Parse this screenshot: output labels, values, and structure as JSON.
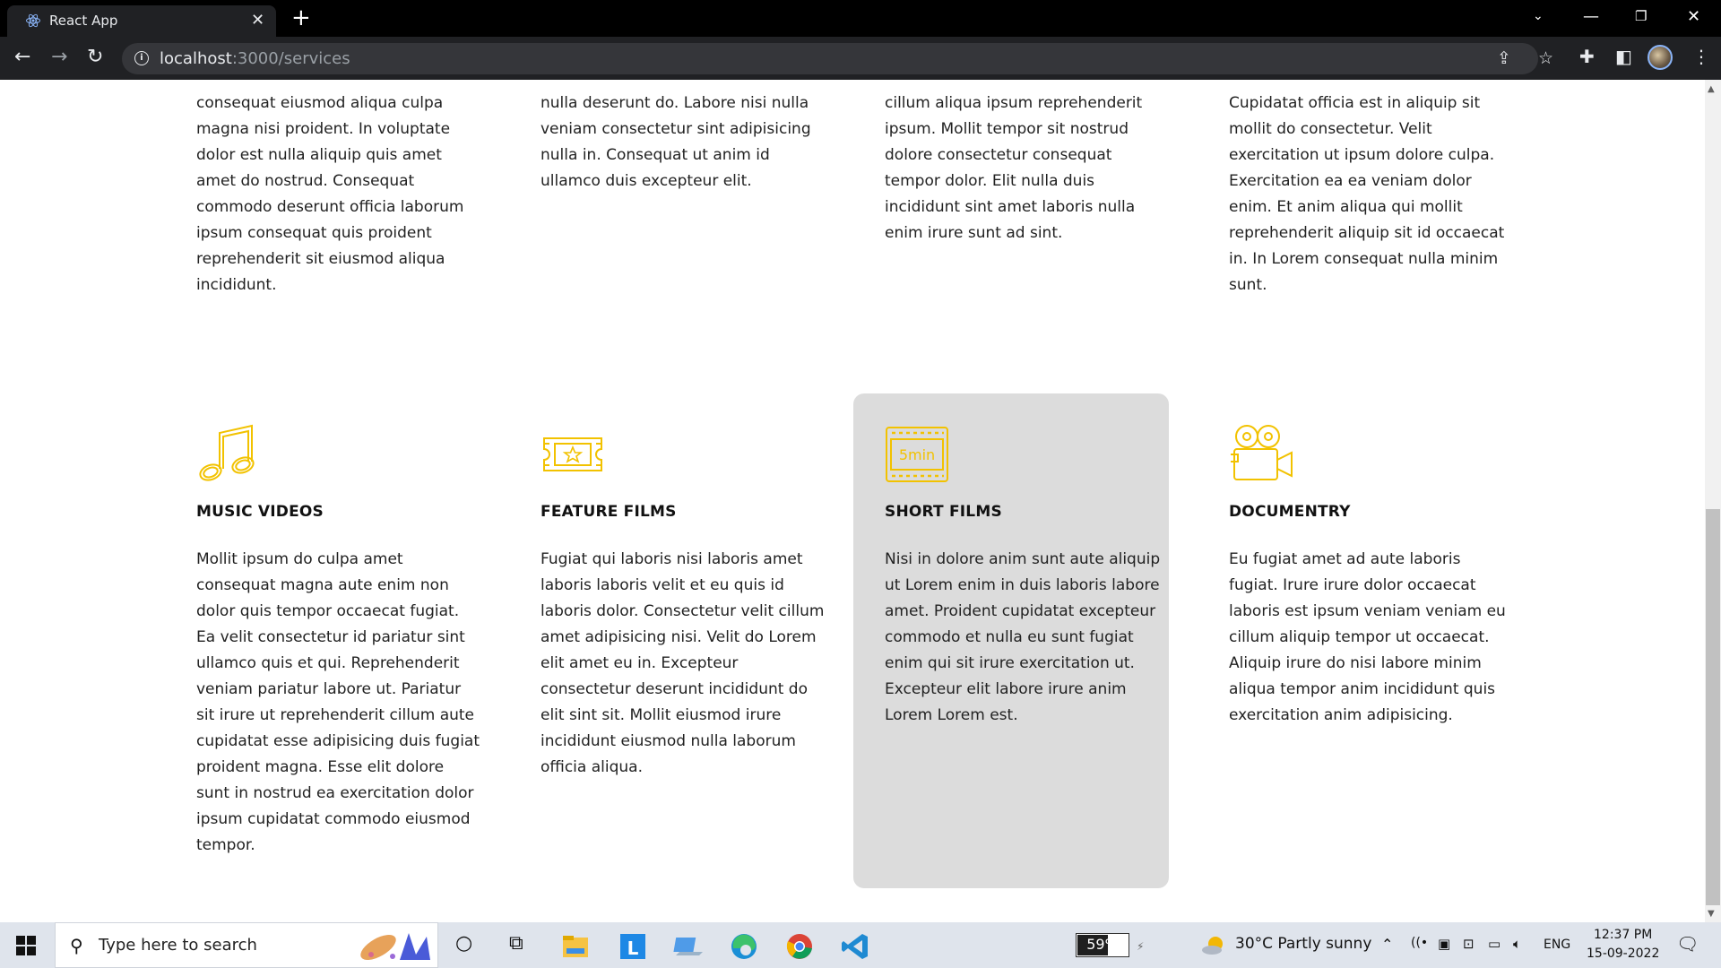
{
  "browser": {
    "tab_title": "React App",
    "url_host": "localhost",
    "url_path": ":3000/services"
  },
  "top_row": [
    "consequat eiusmod aliqua culpa magna nisi proident. In voluptate dolor est nulla aliquip quis amet amet do nostrud. Consequat commodo deserunt officia laborum ipsum consequat quis proident reprehenderit sit eiusmod aliqua incididunt.",
    "nulla deserunt do. Labore nisi nulla veniam consectetur sint adipisicing nulla in. Consequat ut anim id ullamco duis excepteur elit.",
    "cillum aliqua ipsum reprehenderit ipsum. Mollit tempor sit nostrud dolore consectetur consequat tempor dolor. Elit nulla duis incididunt sint amet laboris nulla enim irure sunt ad sint.",
    "Cupidatat officia est in aliquip sit mollit do consectetur. Velit exercitation ut ipsum dolore culpa. Exercitation ea ea veniam dolor enim. Et anim aliqua qui mollit reprehenderit aliquip sit id occaecat in. In Lorem consequat nulla minim sunt."
  ],
  "services": [
    {
      "icon": "music-note-icon",
      "title": "MUSIC VIDEOS",
      "text": "Mollit ipsum do culpa amet consequat magna aute enim non dolor quis tempor occaecat fugiat. Ea velit consectetur id pariatur sint ullamco quis et qui. Reprehenderit veniam pariatur labore ut. Pariatur sit irure ut reprehenderit cillum aute cupidatat esse adipisicing duis fugiat proident magna. Esse elit dolore sunt in nostrud ea exercitation dolor ipsum cupidatat commodo eiusmod tempor."
    },
    {
      "icon": "ticket-star-icon",
      "title": "FEATURE FILMS",
      "text": "Fugiat qui laboris nisi laboris amet laboris laboris velit et eu quis id laboris dolor. Consectetur velit cillum amet adipisicing nisi. Velit do Lorem elit amet eu in. Excepteur consectetur deserunt incididunt do elit sint sit. Mollit eiusmod irure incididunt eiusmod nulla laborum officia aliqua."
    },
    {
      "icon": "film-strip-icon",
      "icon_text": "5min",
      "title": "SHORT FILMS",
      "text": "Nisi in dolore anim sunt aute aliquip ut Lorem enim in duis laboris labore amet. Proident cupidatat excepteur commodo et nulla eu sunt fugiat enim qui sit irure exercitation ut. Excepteur elit labore irure anim Lorem Lorem est."
    },
    {
      "icon": "movie-camera-icon",
      "title": "DOCUMENTRY",
      "text": "Eu fugiat amet ad aute laboris fugiat. Irure irure dolor occaecat laboris est ipsum veniam veniam eu cillum aliquip tempor ut occaecat. Aliquip irure do nisi labore minim aliqua tempor anim incididunt quis exercitation anim adipisicing."
    }
  ],
  "colors": {
    "icon_gold": "#f2c200",
    "card_hover_bg": "#dcdcdc"
  },
  "taskbar": {
    "search_placeholder": "Type here to search",
    "battery_percent": "59%",
    "battery_level": 0.59,
    "weather": "30°C  Partly sunny",
    "language": "ENG",
    "time": "12:37 PM",
    "date": "15-09-2022"
  }
}
